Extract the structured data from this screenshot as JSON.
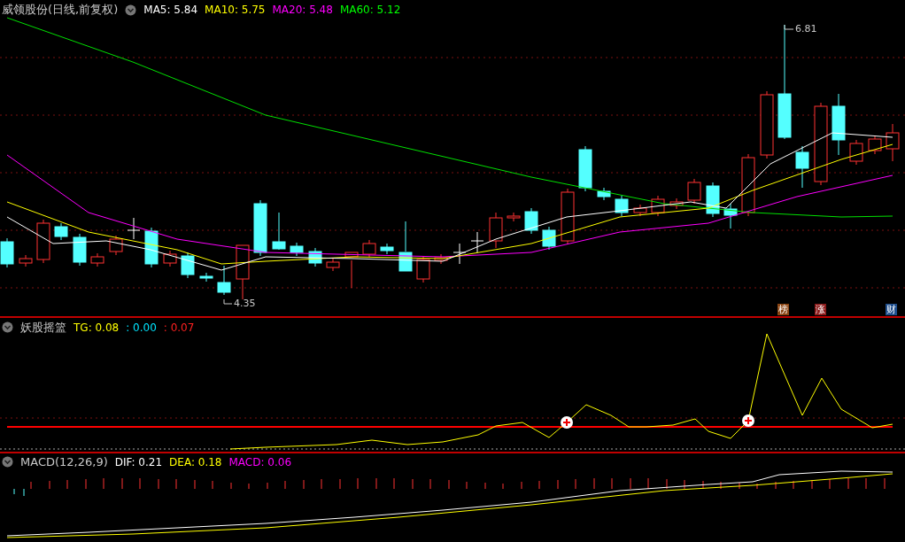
{
  "main_panel": {
    "title": "威领股份(日线,前复权)",
    "indicators": [
      {
        "label": "MA5: 5.84",
        "color": "#ffffff"
      },
      {
        "label": "MA10: 5.75",
        "color": "#ffff00"
      },
      {
        "label": "MA20: 5.48",
        "color": "#ff00ff"
      },
      {
        "label": "MA60: 5.12",
        "color": "#00ff00"
      }
    ],
    "price_labels": [
      {
        "text": "6.81",
        "kind": "high"
      },
      {
        "text": "4.35",
        "kind": "low"
      }
    ],
    "badges": [
      {
        "text": "榜",
        "color": "#8b4513"
      },
      {
        "text": "涨",
        "color": "#8b1a1a"
      },
      {
        "text": "财",
        "color": "#1f4e8c"
      }
    ]
  },
  "indicator_panel": {
    "title": "妖股摇篮",
    "values": [
      {
        "label": "TG: 0.08",
        "color": "#ffff00"
      },
      {
        "label": ": 0.00",
        "color": "#00e5ff"
      },
      {
        "label": ": 0.07",
        "color": "#ff2020"
      }
    ]
  },
  "macd_panel": {
    "title": "MACD(12,26,9)",
    "values": [
      {
        "label": "DIF: 0.21",
        "color": "#ffffff"
      },
      {
        "label": "DEA: 0.18",
        "color": "#ffff00"
      },
      {
        "label": "MACD: 0.06",
        "color": "#ff00ff"
      }
    ]
  }
}
